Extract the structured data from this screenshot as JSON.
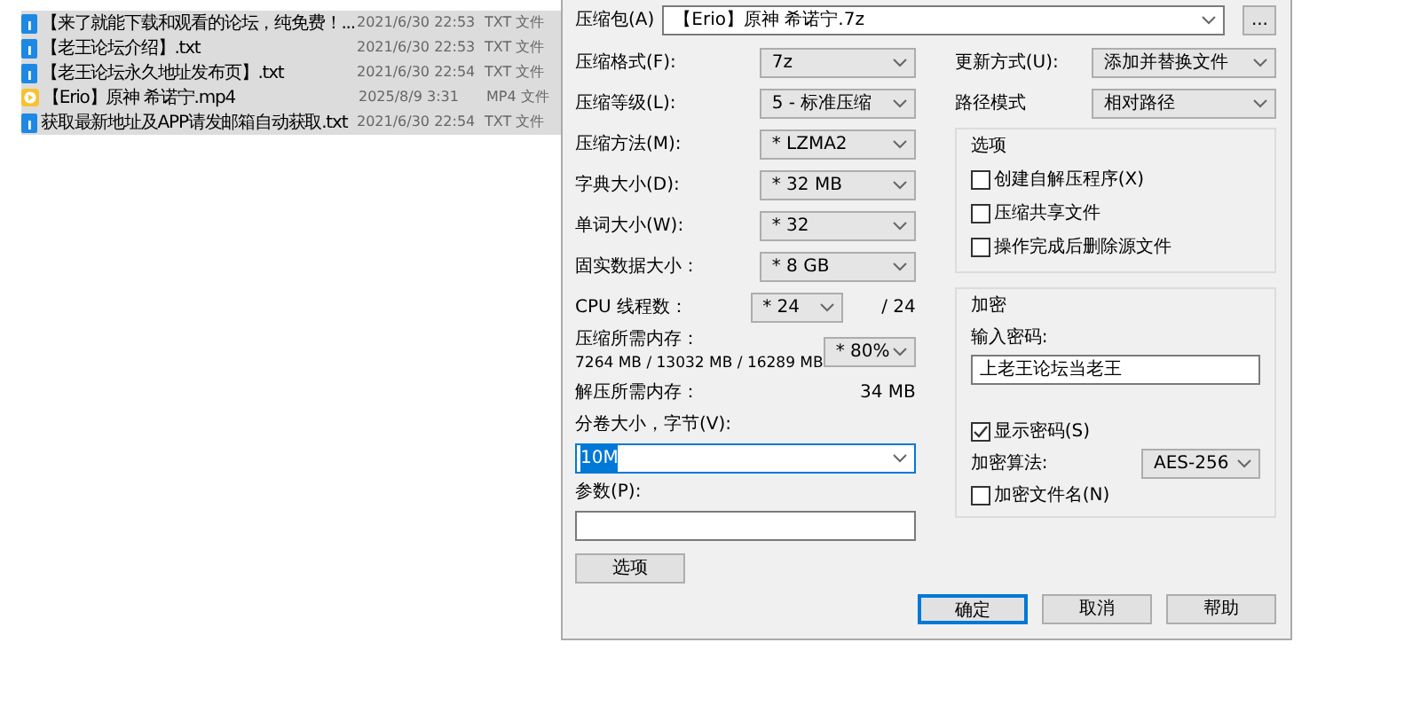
{
  "files": [
    {
      "kind": "txt",
      "name": "【来了就能下载和观看的论坛，纯免费！...",
      "date": "2021/6/30 22:53",
      "type": "TXT 文件"
    },
    {
      "kind": "txt",
      "name": "【老王论坛介绍】.txt",
      "date": "2021/6/30 22:53",
      "type": "TXT 文件"
    },
    {
      "kind": "txt",
      "name": "【老王论坛永久地址发布页】.txt",
      "date": "2021/6/30 22:54",
      "type": "TXT 文件"
    },
    {
      "kind": "video",
      "name": "【Erio】原神 希诺宁.mp4",
      "date": "2025/8/9 3:31",
      "type": "MP4 文件"
    },
    {
      "kind": "txt",
      "name": "获取最新地址及APP请发邮箱自动获取.txt",
      "date": "2021/6/30 22:54",
      "type": "TXT 文件"
    }
  ],
  "dialog": {
    "archive": {
      "label": "压缩包(A)",
      "value": "【Erio】原神 希诺宁.7z",
      "browse": "..."
    },
    "left_fields": [
      {
        "label": "压缩格式(F):",
        "value": "7z"
      },
      {
        "label": "压缩等级(L):",
        "value": "5 - 标准压缩"
      },
      {
        "label": "压缩方法(M):",
        "value": "* LZMA2"
      },
      {
        "label": "字典大小(D):",
        "value": "* 32 MB"
      },
      {
        "label": "单词大小(W):",
        "value": "* 32"
      },
      {
        "label": "固实数据大小：",
        "value": "* 8 GB"
      }
    ],
    "cpu_threads": {
      "label": "CPU 线程数：",
      "value": "* 24",
      "max": "/ 24"
    },
    "memory_compress": {
      "label": "压缩所需内存：",
      "detail": "7264 MB / 13032 MB / 16289 MB",
      "value": "* 80%"
    },
    "memory_decompress": {
      "label": "解压所需内存：",
      "value": "34 MB"
    },
    "split": {
      "label": "分卷大小，字节(V):",
      "value": "10M"
    },
    "params": {
      "label": "参数(P):"
    },
    "options_button": "选项",
    "right_fields": [
      {
        "label": "更新方式(U):",
        "value": "添加并替换文件"
      },
      {
        "label": "路径模式",
        "value": "相对路径"
      }
    ],
    "options_group": {
      "title": "选项",
      "items": [
        {
          "label": "创建自解压程序(X)",
          "checked": false
        },
        {
          "label": "压缩共享文件",
          "checked": false
        },
        {
          "label": "操作完成后删除源文件",
          "checked": false
        }
      ]
    },
    "encryption": {
      "title": "加密",
      "password_label": "输入密码:",
      "password": "上老王论坛当老王",
      "show_password": {
        "label": "显示密码(S)",
        "checked": true
      },
      "method_label": "加密算法:",
      "method": "AES-256",
      "encrypt_names": {
        "label": "加密文件名(N)",
        "checked": false
      }
    },
    "buttons": [
      {
        "label": "确定",
        "default": true
      },
      {
        "label": "取消",
        "default": false
      },
      {
        "label": "帮助",
        "default": false
      }
    ]
  }
}
